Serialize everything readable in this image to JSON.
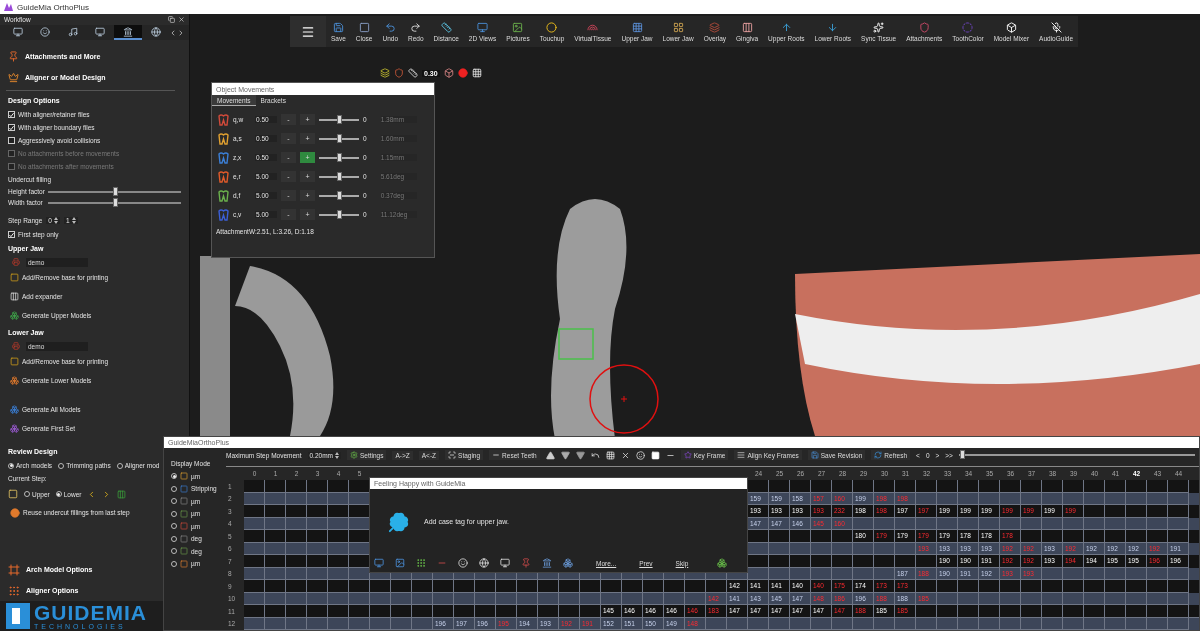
{
  "app_title": "GuideMia OrthoPlus",
  "workflow": {
    "title": "Workflow",
    "tabs": [
      {
        "selected": false
      },
      {
        "selected": false
      },
      {
        "selected": false
      },
      {
        "selected": false
      },
      {
        "selected": true
      },
      {
        "selected": false
      }
    ],
    "sections": [
      {
        "label": "Attachments and More",
        "kind": "pin"
      },
      {
        "label": "Aligner or Model Design",
        "kind": "crown"
      }
    ],
    "design_options": {
      "title": "Design Options",
      "options": [
        {
          "label": "With aligner/retainer files",
          "checked": true,
          "disabled": false
        },
        {
          "label": "With aligner boundary files",
          "checked": true,
          "disabled": false
        },
        {
          "label": "Aggressively avoid collisions",
          "checked": false,
          "disabled": false
        },
        {
          "label": "No attachments before movements",
          "checked": false,
          "disabled": true
        },
        {
          "label": "No attachments after  movements",
          "checked": false,
          "disabled": true
        }
      ],
      "undercut_label": "Undercut filling",
      "sliders": [
        {
          "label": "Height factor",
          "level": 0.5
        },
        {
          "label": "Width factor",
          "level": 0.5
        }
      ],
      "step_range": {
        "label": "Step Range",
        "from": "0",
        "to": "1"
      },
      "first_step": {
        "label": "First step only",
        "checked": true
      }
    },
    "upper_jaw": {
      "title": "Upper Jaw",
      "name": "demo",
      "actions": [
        {
          "label": "Add/Remove base for printing",
          "kind": "base"
        },
        {
          "label": "Add expander",
          "kind": "expander"
        },
        {
          "label": "Generate Upper Models",
          "kind": "upper"
        }
      ]
    },
    "lower_jaw": {
      "title": "Lower Jaw",
      "name": "demo",
      "actions": [
        {
          "label": "Add/Remove base for printing",
          "kind": "base"
        },
        {
          "label": "Generate Lower Models",
          "kind": "lower"
        }
      ]
    },
    "generate_actions": [
      {
        "label": "Generate All Models",
        "kind": "all"
      },
      {
        "label": "Generate First Set",
        "kind": "first"
      }
    ],
    "review_design": {
      "title": "Review Design",
      "modes": [
        {
          "label": "Arch models",
          "selected": true
        },
        {
          "label": "Trimming paths",
          "selected": false
        },
        {
          "label": "Aligner mod",
          "selected": false
        }
      ],
      "current_step_label": "Current Step:",
      "jaws": [
        {
          "label": "Upper",
          "selected": false
        },
        {
          "label": "Lower",
          "selected": true
        }
      ],
      "reuse": "Reuse undercut fillings from last step"
    },
    "bottom_sections": [
      {
        "label": "Arch Model Options",
        "kind": "arch"
      },
      {
        "label": "Aligner Options",
        "kind": "sliders"
      }
    ],
    "logo": {
      "name": "GUIDEMIA",
      "tagline": "TECHNOLOGIES"
    }
  },
  "toolbar": {
    "items": [
      {
        "label": "Save"
      },
      {
        "label": "Close"
      },
      {
        "label": "Undo"
      },
      {
        "label": "Redo"
      },
      {
        "label": "Distance"
      },
      {
        "label": "2D Views"
      },
      {
        "label": "Pictures"
      },
      {
        "label": "Touchup"
      },
      {
        "label": "VirtualTissue"
      },
      {
        "label": "Upper Jaw"
      },
      {
        "label": "Lower Jaw"
      },
      {
        "label": "Overlay"
      },
      {
        "label": "Gingiva"
      },
      {
        "label": "Upper Roots"
      },
      {
        "label": "Lower Roots"
      },
      {
        "label": "Sync Tissue"
      },
      {
        "label": "Attachments"
      },
      {
        "label": "ToothColor"
      },
      {
        "label": "Model Mixer"
      },
      {
        "label": "AudioGuide"
      }
    ]
  },
  "view_controls": {
    "value": "0.30"
  },
  "object_movements": {
    "title": "Object Movements",
    "tabs": [
      {
        "label": "Movements",
        "selected": true
      },
      {
        "label": "Brackets",
        "selected": false
      }
    ],
    "rows": [
      {
        "keys": "q,w",
        "value": "0.50",
        "minus": "-",
        "plus": "+",
        "plus_active": false,
        "level": 0.5,
        "reading": "0",
        "measure": "1.38mm"
      },
      {
        "keys": "a,s",
        "value": "0.50",
        "minus": "-",
        "plus": "+",
        "plus_active": false,
        "level": 0.5,
        "reading": "0",
        "measure": "1.60mm"
      },
      {
        "keys": "z,x",
        "value": "0.50",
        "minus": "-",
        "plus": "+",
        "plus_active": true,
        "level": 0.5,
        "reading": "0",
        "measure": "1.15mm"
      },
      {
        "keys": "e,r",
        "value": "5.00",
        "minus": "-",
        "plus": "+",
        "plus_active": false,
        "level": 0.5,
        "reading": "0",
        "measure": "5.61deg"
      },
      {
        "keys": "d,f",
        "value": "5.00",
        "minus": "-",
        "plus": "+",
        "plus_active": false,
        "level": 0.5,
        "reading": "0",
        "measure": "0.37deg"
      },
      {
        "keys": "c,v",
        "value": "5.00",
        "minus": "-",
        "plus": "+",
        "plus_active": false,
        "level": 0.5,
        "reading": "0",
        "measure": "11.12deg"
      }
    ],
    "footer": "AttachmentW:2.51, L:3.26, D:1.18"
  },
  "staging_window": {
    "title": "GuideMiaOrthoPlus",
    "display_mode": {
      "title": "Display Mode",
      "options": [
        {
          "label": "µm",
          "selected": true
        },
        {
          "label": "Stripping",
          "selected": false
        },
        {
          "label": "µm",
          "selected": false
        },
        {
          "label": "µm",
          "selected": false
        },
        {
          "label": "µm",
          "selected": false
        },
        {
          "label": "deg",
          "selected": false
        },
        {
          "label": "deg",
          "selected": false
        },
        {
          "label": "µm",
          "selected": false
        }
      ]
    },
    "toolbar": {
      "max_step_label": "Maximum Step Movement",
      "max_step_value": "0.20mm",
      "buttons": [
        {
          "label": "Settings",
          "kind": "gear"
        },
        {
          "label": "A->Z",
          "kind": "plain"
        },
        {
          "label": "A<-Z",
          "kind": "plain"
        },
        {
          "label": "Staging",
          "kind": "staging"
        },
        {
          "label": "Reset Teeth",
          "kind": "reset"
        }
      ],
      "after_buttons": [
        {
          "label": "Key Frame",
          "kind": "star"
        },
        {
          "label": "Align Key Frames",
          "kind": "align"
        },
        {
          "label": "Save Revision",
          "kind": "save"
        },
        {
          "label": "Refresh",
          "kind": "refresh"
        }
      ],
      "nav": [
        "<",
        "0",
        ">",
        ">>"
      ],
      "level": 0
    },
    "columns": [
      {
        "label": "0",
        "selected": false
      },
      {
        "label": "1",
        "selected": false
      },
      {
        "label": "2",
        "selected": false
      },
      {
        "label": "3",
        "selected": false
      },
      {
        "label": "4",
        "selected": false
      },
      {
        "label": "5",
        "selected": false
      },
      null,
      null,
      null,
      null,
      null,
      null,
      null,
      null,
      null,
      null,
      null,
      null,
      null,
      null,
      null,
      null,
      null,
      null,
      {
        "label": "24",
        "selected": false
      },
      {
        "label": "25",
        "selected": false
      },
      {
        "label": "26",
        "selected": false
      },
      {
        "label": "27",
        "selected": false
      },
      {
        "label": "28",
        "selected": false
      },
      {
        "label": "29",
        "selected": false
      },
      {
        "label": "30",
        "selected": false
      },
      {
        "label": "31",
        "selected": false
      },
      {
        "label": "32",
        "selected": false
      },
      {
        "label": "33",
        "selected": false
      },
      {
        "label": "34",
        "selected": false
      },
      {
        "label": "35",
        "selected": false
      },
      {
        "label": "36",
        "selected": false
      },
      {
        "label": "37",
        "selected": false
      },
      {
        "label": "38",
        "selected": false
      },
      {
        "label": "39",
        "selected": false
      },
      {
        "label": "40",
        "selected": false
      },
      {
        "label": "41",
        "selected": false
      },
      {
        "label": "42",
        "selected": true
      },
      {
        "label": "43",
        "selected": false
      },
      {
        "label": "44",
        "selected": false
      }
    ],
    "rows": [
      {
        "label": "1",
        "cells": [
          null,
          null,
          null,
          null,
          null,
          null,
          null,
          null,
          null,
          null,
          null,
          null,
          null,
          null,
          null,
          null,
          null,
          null,
          null,
          null,
          null,
          null,
          null,
          null,
          null,
          null,
          null,
          null,
          null,
          null,
          null,
          null,
          null,
          null,
          null,
          null,
          null,
          null,
          null,
          null,
          null,
          null,
          null,
          null,
          null
        ]
      },
      {
        "label": "2",
        "cells": [
          null,
          null,
          null,
          null,
          null,
          null,
          null,
          null,
          null,
          null,
          null,
          null,
          null,
          null,
          null,
          null,
          null,
          null,
          null,
          null,
          null,
          null,
          null,
          null,
          {
            "value": "159",
            "exceeds": false
          },
          {
            "value": "159",
            "exceeds": false
          },
          {
            "value": "158",
            "exceeds": false
          },
          {
            "value": "157",
            "exceeds": true
          },
          {
            "value": "160",
            "exceeds": true
          },
          {
            "value": "199",
            "exceeds": false
          },
          {
            "value": "198",
            "exceeds": true
          },
          {
            "value": "198",
            "exceeds": true
          },
          null,
          null,
          null,
          null,
          null,
          null,
          null,
          null,
          null,
          null,
          null,
          null,
          null
        ]
      },
      {
        "label": "3",
        "cells": [
          null,
          null,
          null,
          null,
          null,
          null,
          null,
          null,
          null,
          null,
          null,
          null,
          null,
          null,
          null,
          null,
          null,
          null,
          null,
          null,
          null,
          null,
          null,
          null,
          {
            "value": "193",
            "exceeds": false
          },
          {
            "value": "193",
            "exceeds": false
          },
          {
            "value": "193",
            "exceeds": false
          },
          {
            "value": "193",
            "exceeds": true
          },
          {
            "value": "232",
            "exceeds": true
          },
          {
            "value": "198",
            "exceeds": false
          },
          {
            "value": "198",
            "exceeds": true
          },
          {
            "value": "197",
            "exceeds": false
          },
          {
            "value": "197",
            "exceeds": true
          },
          {
            "value": "199",
            "exceeds": false
          },
          {
            "value": "199",
            "exceeds": false
          },
          {
            "value": "199",
            "exceeds": false
          },
          {
            "value": "199",
            "exceeds": true
          },
          {
            "value": "199",
            "exceeds": true
          },
          {
            "value": "199",
            "exceeds": false
          },
          {
            "value": "199",
            "exceeds": true
          },
          null,
          null,
          null,
          null,
          null
        ]
      },
      {
        "label": "4",
        "cells": [
          null,
          null,
          null,
          null,
          null,
          null,
          null,
          null,
          null,
          null,
          null,
          null,
          null,
          null,
          null,
          null,
          null,
          null,
          null,
          null,
          null,
          null,
          null,
          null,
          {
            "value": "147",
            "exceeds": false
          },
          {
            "value": "147",
            "exceeds": false
          },
          {
            "value": "146",
            "exceeds": false
          },
          {
            "value": "145",
            "exceeds": true
          },
          {
            "value": "160",
            "exceeds": true
          },
          null,
          null,
          null,
          null,
          null,
          null,
          null,
          null,
          null,
          null,
          null,
          null,
          null,
          null,
          null,
          null
        ]
      },
      {
        "label": "5",
        "cells": [
          null,
          null,
          null,
          null,
          null,
          null,
          null,
          null,
          null,
          null,
          null,
          null,
          null,
          null,
          null,
          null,
          null,
          null,
          null,
          null,
          null,
          null,
          null,
          null,
          null,
          null,
          null,
          null,
          null,
          {
            "value": "180",
            "exceeds": false
          },
          {
            "value": "179",
            "exceeds": true
          },
          {
            "value": "179",
            "exceeds": false
          },
          {
            "value": "179",
            "exceeds": true
          },
          {
            "value": "179",
            "exceeds": false
          },
          {
            "value": "178",
            "exceeds": false
          },
          {
            "value": "178",
            "exceeds": false
          },
          {
            "value": "178",
            "exceeds": true
          },
          null,
          null,
          null,
          null,
          null,
          null,
          null,
          null
        ]
      },
      {
        "label": "6",
        "cells": [
          null,
          null,
          null,
          null,
          null,
          null,
          null,
          null,
          null,
          null,
          null,
          null,
          null,
          null,
          null,
          null,
          null,
          null,
          null,
          null,
          null,
          null,
          null,
          null,
          null,
          null,
          null,
          null,
          null,
          null,
          null,
          null,
          {
            "value": "193",
            "exceeds": true
          },
          {
            "value": "193",
            "exceeds": false
          },
          {
            "value": "193",
            "exceeds": false
          },
          {
            "value": "193",
            "exceeds": false
          },
          {
            "value": "192",
            "exceeds": true
          },
          {
            "value": "192",
            "exceeds": true
          },
          {
            "value": "193",
            "exceeds": false
          },
          {
            "value": "192",
            "exceeds": true
          },
          {
            "value": "192",
            "exceeds": false
          },
          {
            "value": "192",
            "exceeds": false
          },
          {
            "value": "192",
            "exceeds": false
          },
          {
            "value": "192",
            "exceeds": true
          },
          {
            "value": "191",
            "exceeds": false
          }
        ]
      },
      {
        "label": "7",
        "cells": [
          null,
          null,
          null,
          null,
          null,
          null,
          null,
          null,
          null,
          null,
          null,
          null,
          null,
          null,
          null,
          null,
          null,
          null,
          null,
          null,
          null,
          null,
          null,
          null,
          null,
          null,
          null,
          null,
          null,
          null,
          null,
          null,
          null,
          {
            "value": "190",
            "exceeds": false
          },
          {
            "value": "190",
            "exceeds": false
          },
          {
            "value": "191",
            "exceeds": false
          },
          {
            "value": "192",
            "exceeds": true
          },
          {
            "value": "192",
            "exceeds": true
          },
          {
            "value": "193",
            "exceeds": false
          },
          {
            "value": "194",
            "exceeds": true
          },
          {
            "value": "194",
            "exceeds": false
          },
          {
            "value": "195",
            "exceeds": false
          },
          {
            "value": "195",
            "exceeds": false
          },
          {
            "value": "196",
            "exceeds": true
          },
          {
            "value": "196",
            "exceeds": false
          }
        ]
      },
      {
        "label": "8",
        "cells": [
          null,
          null,
          null,
          null,
          null,
          null,
          null,
          null,
          null,
          null,
          null,
          null,
          null,
          null,
          null,
          null,
          null,
          null,
          null,
          null,
          null,
          null,
          null,
          null,
          null,
          null,
          null,
          null,
          null,
          null,
          null,
          {
            "value": "187",
            "exceeds": false
          },
          {
            "value": "188",
            "exceeds": true
          },
          {
            "value": "190",
            "exceeds": false
          },
          {
            "value": "191",
            "exceeds": false
          },
          {
            "value": "192",
            "exceeds": false
          },
          {
            "value": "193",
            "exceeds": true
          },
          {
            "value": "193",
            "exceeds": true
          },
          null,
          null,
          null,
          null,
          null,
          null,
          null
        ]
      },
      {
        "label": "9",
        "cells": [
          null,
          null,
          null,
          null,
          null,
          null,
          null,
          null,
          null,
          null,
          null,
          null,
          null,
          null,
          null,
          null,
          null,
          null,
          null,
          null,
          null,
          null,
          null,
          {
            "value": "142",
            "exceeds": false
          },
          {
            "value": "141",
            "exceeds": false
          },
          {
            "value": "141",
            "exceeds": false
          },
          {
            "value": "140",
            "exceeds": false
          },
          {
            "value": "140",
            "exceeds": true
          },
          {
            "value": "175",
            "exceeds": true
          },
          {
            "value": "174",
            "exceeds": false
          },
          {
            "value": "173",
            "exceeds": true
          },
          {
            "value": "173",
            "exceeds": true
          },
          null,
          null,
          null,
          null,
          null,
          null,
          null,
          null,
          null,
          null,
          null,
          null,
          null
        ]
      },
      {
        "label": "10",
        "cells": [
          null,
          null,
          null,
          null,
          null,
          null,
          null,
          null,
          null,
          null,
          null,
          null,
          null,
          null,
          null,
          null,
          null,
          null,
          null,
          null,
          null,
          null,
          {
            "value": "142",
            "exceeds": true
          },
          {
            "value": "141",
            "exceeds": false
          },
          {
            "value": "143",
            "exceeds": false
          },
          {
            "value": "145",
            "exceeds": false
          },
          {
            "value": "147",
            "exceeds": false
          },
          {
            "value": "148",
            "exceeds": true
          },
          {
            "value": "186",
            "exceeds": true
          },
          {
            "value": "196",
            "exceeds": false
          },
          {
            "value": "188",
            "exceeds": true
          },
          {
            "value": "188",
            "exceeds": false
          },
          {
            "value": "185",
            "exceeds": true
          },
          null,
          null,
          null,
          null,
          null,
          null,
          null,
          null,
          null,
          null,
          null,
          null
        ]
      },
      {
        "label": "11",
        "cells": [
          null,
          null,
          null,
          null,
          null,
          null,
          null,
          null,
          null,
          null,
          null,
          null,
          null,
          null,
          null,
          null,
          null,
          {
            "value": "145",
            "exceeds": false
          },
          {
            "value": "146",
            "exceeds": false
          },
          {
            "value": "146",
            "exceeds": false
          },
          {
            "value": "146",
            "exceeds": false
          },
          {
            "value": "146",
            "exceeds": true
          },
          {
            "value": "183",
            "exceeds": true
          },
          {
            "value": "147",
            "exceeds": false
          },
          {
            "value": "147",
            "exceeds": false
          },
          {
            "value": "147",
            "exceeds": false
          },
          {
            "value": "147",
            "exceeds": false
          },
          {
            "value": "147",
            "exceeds": false
          },
          {
            "value": "147",
            "exceeds": true
          },
          {
            "value": "188",
            "exceeds": true
          },
          {
            "value": "185",
            "exceeds": false
          },
          {
            "value": "185",
            "exceeds": true
          },
          null,
          null,
          null,
          null,
          null,
          null,
          null,
          null,
          null,
          null,
          null,
          null,
          null,
          null
        ]
      },
      {
        "label": "12",
        "cells": [
          null,
          null,
          null,
          null,
          null,
          null,
          null,
          null,
          null,
          {
            "value": "196",
            "exceeds": false
          },
          {
            "value": "197",
            "exceeds": false
          },
          {
            "value": "196",
            "exceeds": false
          },
          {
            "value": "195",
            "exceeds": true
          },
          {
            "value": "194",
            "exceeds": false
          },
          {
            "value": "193",
            "exceeds": false
          },
          {
            "value": "192",
            "exceeds": true
          },
          {
            "value": "191",
            "exceeds": true
          },
          {
            "value": "152",
            "exceeds": false
          },
          {
            "value": "151",
            "exceeds": false
          },
          {
            "value": "150",
            "exceeds": false
          },
          {
            "value": "149",
            "exceeds": false
          },
          {
            "value": "148",
            "exceeds": true
          },
          null,
          null,
          null,
          null,
          null,
          null,
          null,
          null,
          null,
          null,
          null,
          null,
          null,
          null,
          null,
          null,
          null,
          null,
          null,
          null,
          null,
          null,
          null
        ]
      }
    ],
    "popup": {
      "title": "Feeling Happy with GuideMia",
      "message": "Add case tag for upper jaw.",
      "links": [
        "More...",
        "Prev",
        "Skip"
      ]
    }
  }
}
